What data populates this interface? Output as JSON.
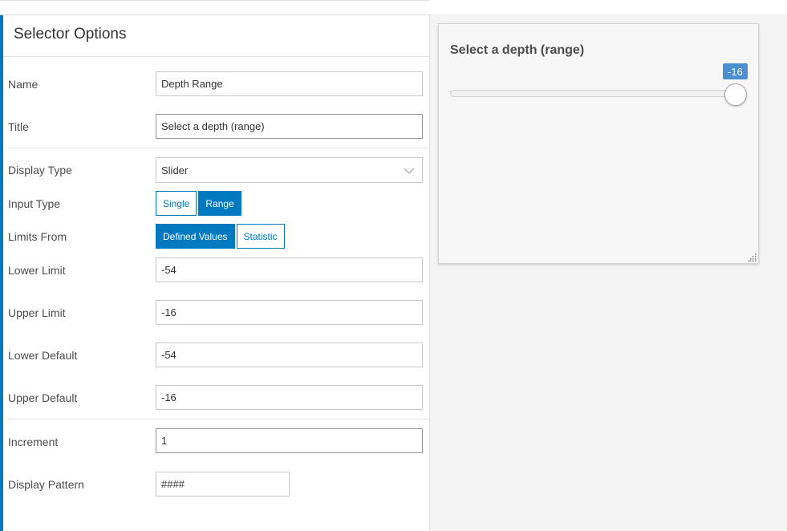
{
  "left_panel": {
    "title": "Selector Options",
    "name": {
      "label": "Name",
      "value": "Depth Range"
    },
    "title_field": {
      "label": "Title",
      "value": "Select a depth (range)"
    },
    "display_type": {
      "label": "Display Type",
      "value": "Slider"
    },
    "input_type": {
      "label": "Input Type",
      "options": [
        "Single",
        "Range"
      ],
      "selected": "Range"
    },
    "limits_from": {
      "label": "Limits From",
      "options": [
        "Defined Values",
        "Statistic"
      ],
      "selected": "Defined Values"
    },
    "lower_limit": {
      "label": "Lower Limit",
      "value": "-54"
    },
    "upper_limit": {
      "label": "Upper Limit",
      "value": "-16"
    },
    "lower_default": {
      "label": "Lower Default",
      "value": "-54"
    },
    "upper_default": {
      "label": "Upper Default",
      "value": "-16"
    },
    "increment": {
      "label": "Increment",
      "value": "1"
    },
    "display_pattern": {
      "label": "Display Pattern",
      "value": "####"
    }
  },
  "preview": {
    "widget_title": "Select a depth (range)",
    "slider": {
      "min": -54,
      "max": -16,
      "value": -16,
      "value_label": "-16"
    }
  },
  "colors": {
    "accent": "#0079c1",
    "badge": "#4a8fd0"
  },
  "icons": {
    "dropdown": "chevron-down-icon",
    "resize": "resize-grip-icon"
  }
}
